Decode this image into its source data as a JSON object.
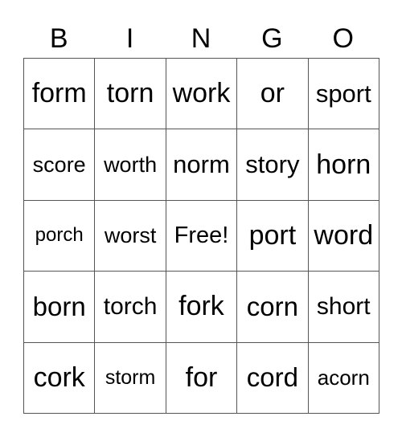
{
  "header": [
    "B",
    "I",
    "N",
    "G",
    "O"
  ],
  "rows": [
    [
      "form",
      "torn",
      "work",
      "or",
      "sport"
    ],
    [
      "score",
      "worth",
      "norm",
      "story",
      "horn"
    ],
    [
      "porch",
      "worst",
      "Free!",
      "port",
      "word"
    ],
    [
      "born",
      "torch",
      "fork",
      "corn",
      "short"
    ],
    [
      "cork",
      "storm",
      "for",
      "cord",
      "acorn"
    ]
  ]
}
